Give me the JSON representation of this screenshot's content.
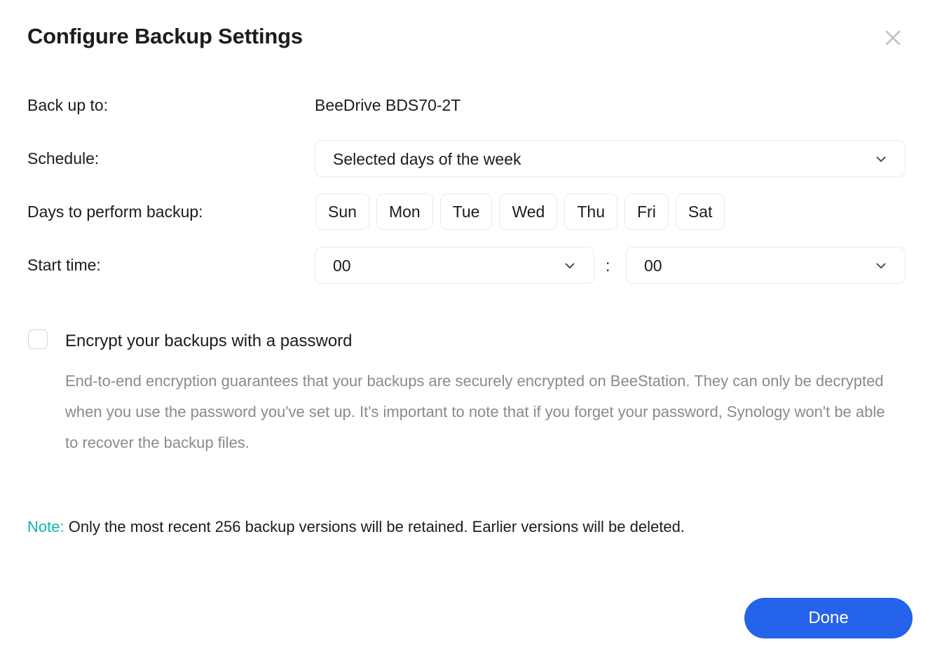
{
  "dialog": {
    "title": "Configure Backup Settings",
    "close_icon": "close-icon"
  },
  "form": {
    "backup_to": {
      "label": "Back up to:",
      "value": "BeeDrive BDS70-2T"
    },
    "schedule": {
      "label": "Schedule:",
      "value": "Selected days of the week",
      "chevron_icon": "chevron-down-icon"
    },
    "days": {
      "label": "Days to perform backup:",
      "options": [
        {
          "label": "Sun",
          "selected": false
        },
        {
          "label": "Mon",
          "selected": false
        },
        {
          "label": "Tue",
          "selected": false
        },
        {
          "label": "Wed",
          "selected": false
        },
        {
          "label": "Thu",
          "selected": false
        },
        {
          "label": "Fri",
          "selected": false
        },
        {
          "label": "Sat",
          "selected": false
        }
      ]
    },
    "start_time": {
      "label": "Start time:",
      "hour": "00",
      "minute": "00",
      "separator": ":"
    }
  },
  "encryption": {
    "checkbox_checked": false,
    "label": "Encrypt your backups with a password",
    "description": "End-to-end encryption guarantees that your backups are securely encrypted on BeeStation. They can only be decrypted when you use the password you've set up. It's important to note that if you forget your password, Synology won't be able to recover the backup files."
  },
  "note": {
    "prefix": "Note:",
    "text": " Only the most recent 256 backup versions will be retained. Earlier versions will be deleted."
  },
  "footer": {
    "done_label": "Done"
  },
  "colors": {
    "accent_blue": "#2563eb",
    "note_teal": "#12b5b0",
    "border_gray": "#e8eaed",
    "muted_text": "#8a8a8e",
    "text": "#1c1c1e"
  }
}
